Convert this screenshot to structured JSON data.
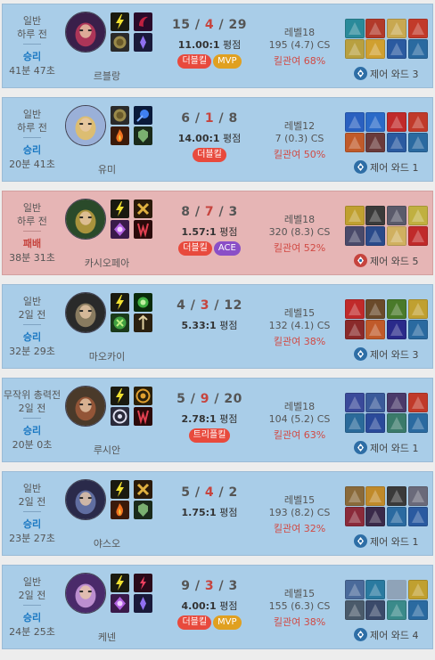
{
  "matches": [
    {
      "result_type": "win",
      "game_type": "일반",
      "time_ago": "하루 전",
      "result": "승리",
      "duration": "41분 47초",
      "champion": "르블랑",
      "champ_color": [
        "#3a1f4a",
        "#c23a5a"
      ],
      "spells": [
        "flash",
        "exhaust"
      ],
      "runes": [
        "dark-harvest",
        "sorcery"
      ],
      "kda": {
        "kills": "15",
        "deaths": "4",
        "assists": "29"
      },
      "ratio_value": "11.00:1",
      "ratio_label": "평점",
      "badges": [
        {
          "text": "더블킬",
          "color": "red"
        },
        {
          "text": "MVP",
          "color": "gold"
        }
      ],
      "level": "레벨18",
      "cs": "195 (4.7) CS",
      "kill_participation": "킬관여 68%",
      "items": [
        "#2a8a9a",
        "#b23a2a",
        "#c8a850",
        "#c23a2a",
        "#b8a040",
        "#d0a030",
        "#2a5aa0",
        "#2a6aa0"
      ],
      "ward": "제어 와드 3"
    },
    {
      "result_type": "win",
      "game_type": "일반",
      "time_ago": "하루 전",
      "result": "승리",
      "duration": "20분 41초",
      "champion": "유미",
      "champ_color": [
        "#9ab0d8",
        "#e8c060"
      ],
      "spells": [
        "exhaust",
        "ignite"
      ],
      "runes": [
        "arcane-comet",
        "resolve"
      ],
      "kda": {
        "kills": "6",
        "deaths": "1",
        "assists": "8"
      },
      "ratio_value": "14.00:1",
      "ratio_label": "평점",
      "badges": [
        {
          "text": "더블킬",
          "color": "red"
        }
      ],
      "level": "레벨12",
      "cs": "7 (0.3) CS",
      "kill_participation": "킬관여 50%",
      "items": [
        "#2a60c0",
        "#2a6ac8",
        "#c02a2a",
        "#c03a2a",
        "#c05a2a",
        "#6a3a3a",
        "#2a5aa0",
        "#2a6aa0"
      ],
      "ward": "제어 와드 1"
    },
    {
      "result_type": "loss",
      "game_type": "일반",
      "time_ago": "하루 전",
      "result": "패배",
      "duration": "38분 31초",
      "champion": "카시오페아",
      "champ_color": [
        "#2a4a2a",
        "#c0a040"
      ],
      "spells": [
        "flash",
        "teleport"
      ],
      "runes": [
        "conqueror",
        "domination"
      ],
      "kda": {
        "kills": "8",
        "deaths": "7",
        "assists": "3"
      },
      "ratio_value": "1.57:1",
      "ratio_label": "평점",
      "badges": [
        {
          "text": "더블킬",
          "color": "red"
        },
        {
          "text": "ACE",
          "color": "purple"
        }
      ],
      "level": "레벨18",
      "cs": "320 (8.3) CS",
      "kill_participation": "킬관여 52%",
      "items": [
        "#c0a030",
        "#3a3a3a",
        "#5a5a6a",
        "#c0b040",
        "#4a4a6a",
        "#2a4a8a",
        "#d0b060",
        "#c02a2a"
      ],
      "ward": "제어 와드 5"
    },
    {
      "result_type": "win",
      "game_type": "일반",
      "time_ago": "2일 전",
      "result": "승리",
      "duration": "32분 29초",
      "champion": "마오카이",
      "champ_color": [
        "#2a2a2a",
        "#9a8a6a"
      ],
      "spells": [
        "flash",
        "smite"
      ],
      "runes": [
        "guardian",
        "precision"
      ],
      "kda": {
        "kills": "4",
        "deaths": "3",
        "assists": "12"
      },
      "ratio_value": "5.33:1",
      "ratio_label": "평점",
      "badges": [],
      "level": "레벨15",
      "cs": "132 (4.1) CS",
      "kill_participation": "킬관여 38%",
      "items": [
        "#c02a2a",
        "#6a4a2a",
        "#4a7a2a",
        "#c0a030",
        "#8a2a2a",
        "#c05a2a",
        "#2a2a8a",
        "#2a6aa0"
      ],
      "ward": "제어 와드 3"
    },
    {
      "result_type": "win",
      "game_type": "무작위 총력전",
      "time_ago": "2일 전",
      "result": "승리",
      "duration": "20분 0초",
      "champion": "루시안",
      "champ_color": [
        "#4a3a2a",
        "#a05a3a"
      ],
      "spells": [
        "flash",
        "mark"
      ],
      "runes": [
        "press-attack",
        "domination"
      ],
      "kda": {
        "kills": "5",
        "deaths": "9",
        "assists": "20"
      },
      "ratio_value": "2.78:1",
      "ratio_label": "평점",
      "badges": [
        {
          "text": "트리플킬",
          "color": "red"
        }
      ],
      "level": "레벨18",
      "cs": "104 (5.2) CS",
      "kill_participation": "킬관여 63%",
      "items": [
        "#3a4a9a",
        "#3a5a9a",
        "#4a3a6a",
        "#c03a2a",
        "#2a6a9a",
        "#2a4a9a",
        "#3a7a6a",
        "#2a6aa0"
      ],
      "ward": "제어 와드 1"
    },
    {
      "result_type": "win",
      "game_type": "일반",
      "time_ago": "2일 전",
      "result": "승리",
      "duration": "23분 27초",
      "champion": "야스오",
      "champ_color": [
        "#2a2a4a",
        "#6a7ab0"
      ],
      "spells": [
        "flash",
        "ignite"
      ],
      "runes": [
        "conqueror",
        "resolve"
      ],
      "kda": {
        "kills": "5",
        "deaths": "4",
        "assists": "2"
      },
      "ratio_value": "1.75:1",
      "ratio_label": "평점",
      "badges": [],
      "level": "레벨15",
      "cs": "193 (8.2) CS",
      "kill_participation": "킬관여 32%",
      "items": [
        "#8a6a3a",
        "#c08a2a",
        "#3a3a3a",
        "#6a6a7a",
        "#8a2a3a",
        "#3a2a4a",
        "#2a6aa0",
        "#2a5aa0"
      ],
      "ward": "제어 와드 1"
    },
    {
      "result_type": "win",
      "game_type": "일반",
      "time_ago": "2일 전",
      "result": "승리",
      "duration": "24분 25초",
      "champion": "케넨",
      "champ_color": [
        "#4a2a6a",
        "#d0a0e0"
      ],
      "spells": [
        "flash",
        "teleport"
      ],
      "runes": [
        "electrocute",
        "sorcery"
      ],
      "kda": {
        "kills": "9",
        "deaths": "3",
        "assists": "3"
      },
      "ratio_value": "4.00:1",
      "ratio_label": "평점",
      "badges": [
        {
          "text": "더블킬",
          "color": "red"
        },
        {
          "text": "MVP",
          "color": "gold"
        }
      ],
      "level": "레벨15",
      "cs": "155 (6.3) CS",
      "kill_participation": "킬관여 38%",
      "items": [
        "#4a6a9a",
        "#2a7aa0",
        "",
        "#c0a030",
        "#4a5a6a",
        "#3a4a6a",
        "#3a8a8a",
        "#2a6aa0"
      ],
      "ward": "제어 와드 4"
    }
  ]
}
